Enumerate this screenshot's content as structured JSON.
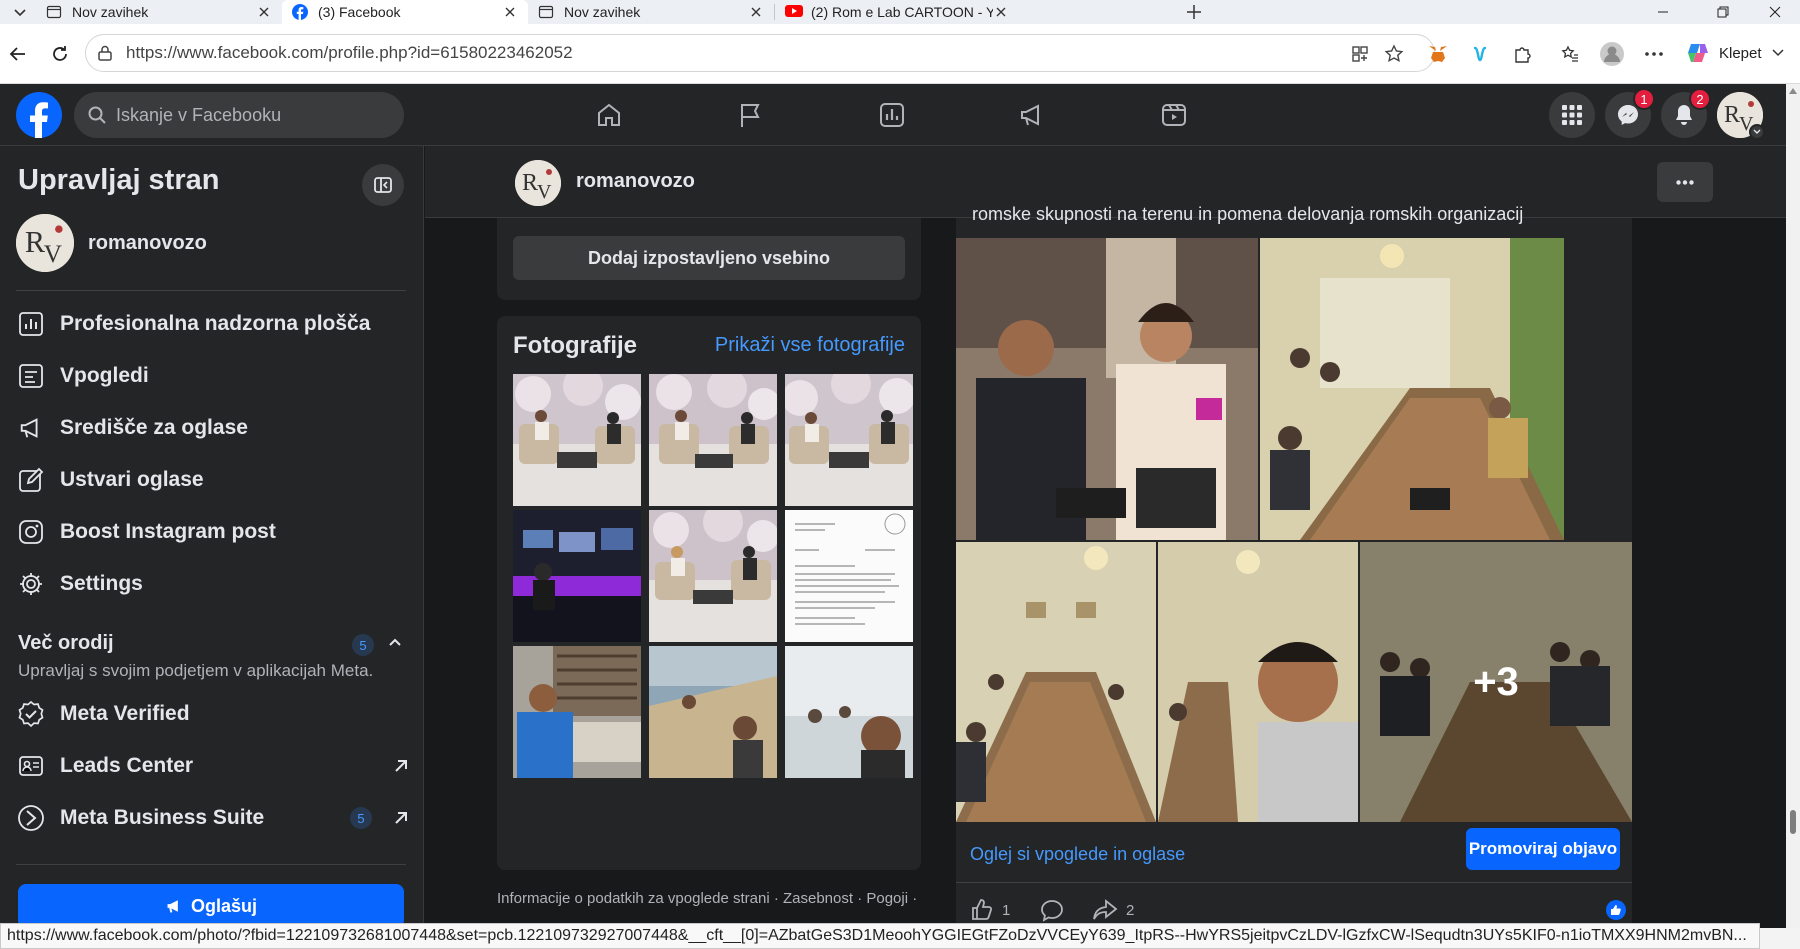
{
  "browser": {
    "tabs": [
      {
        "title": "Nov zavihek",
        "icon": "new-tab-icon",
        "active": false
      },
      {
        "title": "(3) Facebook",
        "icon": "facebook-icon",
        "active": true
      },
      {
        "title": "Nov zavihek",
        "icon": "new-tab-icon",
        "active": false
      },
      {
        "title": "(2) Rom e Lab CARTOON - YouTub",
        "icon": "youtube-icon",
        "active": false
      }
    ],
    "url": "https://www.facebook.com/profile.php?id=61580223462052",
    "copilot_label": "Klepet",
    "status_url": "https://www.facebook.com/photo/?fbid=122109732681007448&set=pcb.122109732927007448&__cft__[0]=AZbatGeS3D1MeoohYGGIEGtFZoDzVVCEyY639_ItpRS--HwYRS5jeitpvCzLDV-lGzfxCW-lSequdtn3UYs5KIF0-n1ioTMXX9HNM2mvBN..."
  },
  "facebook": {
    "search_placeholder": "Iskanje v Facebooku",
    "messenger_badge": "1",
    "notifications_badge": "2",
    "accent": "#0866ff"
  },
  "sidebar": {
    "title": "Upravljaj stran",
    "page_name": "romanovozo",
    "items": [
      {
        "label": "Profesionalna nadzorna plošča",
        "icon": "dashboard-icon"
      },
      {
        "label": "Vpogledi",
        "icon": "insights-icon"
      },
      {
        "label": "Središče za oglase",
        "icon": "megaphone-icon"
      },
      {
        "label": "Ustvari oglase",
        "icon": "edit-icon"
      },
      {
        "label": "Boost Instagram post",
        "icon": "instagram-icon"
      },
      {
        "label": "Settings",
        "icon": "gear-icon"
      }
    ],
    "tools_title": "Več orodij",
    "tools_count": "5",
    "tools_subtitle": "Upravljaj s svojim podjetjem v aplikacijah Meta.",
    "tools": [
      {
        "label": "Meta Verified",
        "icon": "verified-icon"
      },
      {
        "label": "Leads Center",
        "icon": "leads-icon"
      },
      {
        "label": "Meta Business Suite",
        "icon": "business-suite-icon",
        "count": "5"
      }
    ],
    "advertise_label": "Oglašuj"
  },
  "page": {
    "name": "romanovozo",
    "featured_button": "Dodaj izpostavljeno vsebino",
    "photos_title": "Fotografije",
    "photos_see_all": "Prikaži vse fotografije",
    "footer": "Informacije o podatkih za vpoglede strani · Zasebnost · Pogoji ·"
  },
  "post": {
    "text_cut": "romske skupnosti na terenu in pomena delovanja romskih organizacij",
    "more_photos": "+3",
    "insights_link": "Oglej si vpoglede in oglase",
    "promote_label": "Promoviraj objavo",
    "likes": "1",
    "shares": "2"
  }
}
